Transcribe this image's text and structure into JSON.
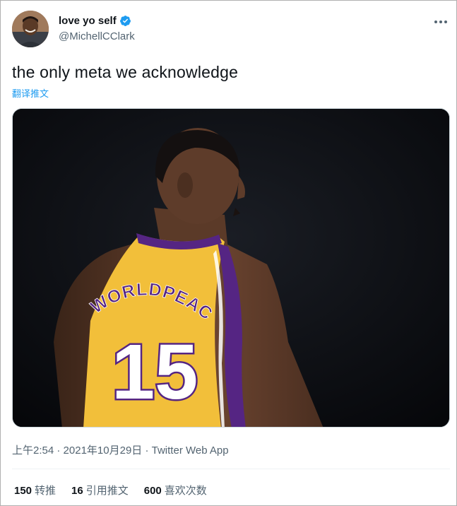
{
  "author": {
    "display_name": "love yo self",
    "handle": "@MichellCClark",
    "verified": true,
    "avatar_icon": "avatar-photo"
  },
  "tweet": {
    "text": "the only meta we acknowledge",
    "translate_label": "翻译推文"
  },
  "media": {
    "jersey_name": "WORLDPEACE",
    "jersey_number": "15"
  },
  "meta": {
    "time": "上午2:54",
    "sep1": " · ",
    "date": "2021年10月29日",
    "sep2": " · ",
    "source": "Twitter Web App"
  },
  "stats": {
    "retweets_count": "150",
    "retweets_label": "转推",
    "quotes_count": "16",
    "quotes_label": "引用推文",
    "likes_count": "600",
    "likes_label": "喜欢次数"
  },
  "colors": {
    "accent": "#1d9bf0",
    "text": "#0f1419",
    "secondary": "#536471",
    "jersey_gold": "#f2bf3a",
    "jersey_purple": "#552583"
  }
}
